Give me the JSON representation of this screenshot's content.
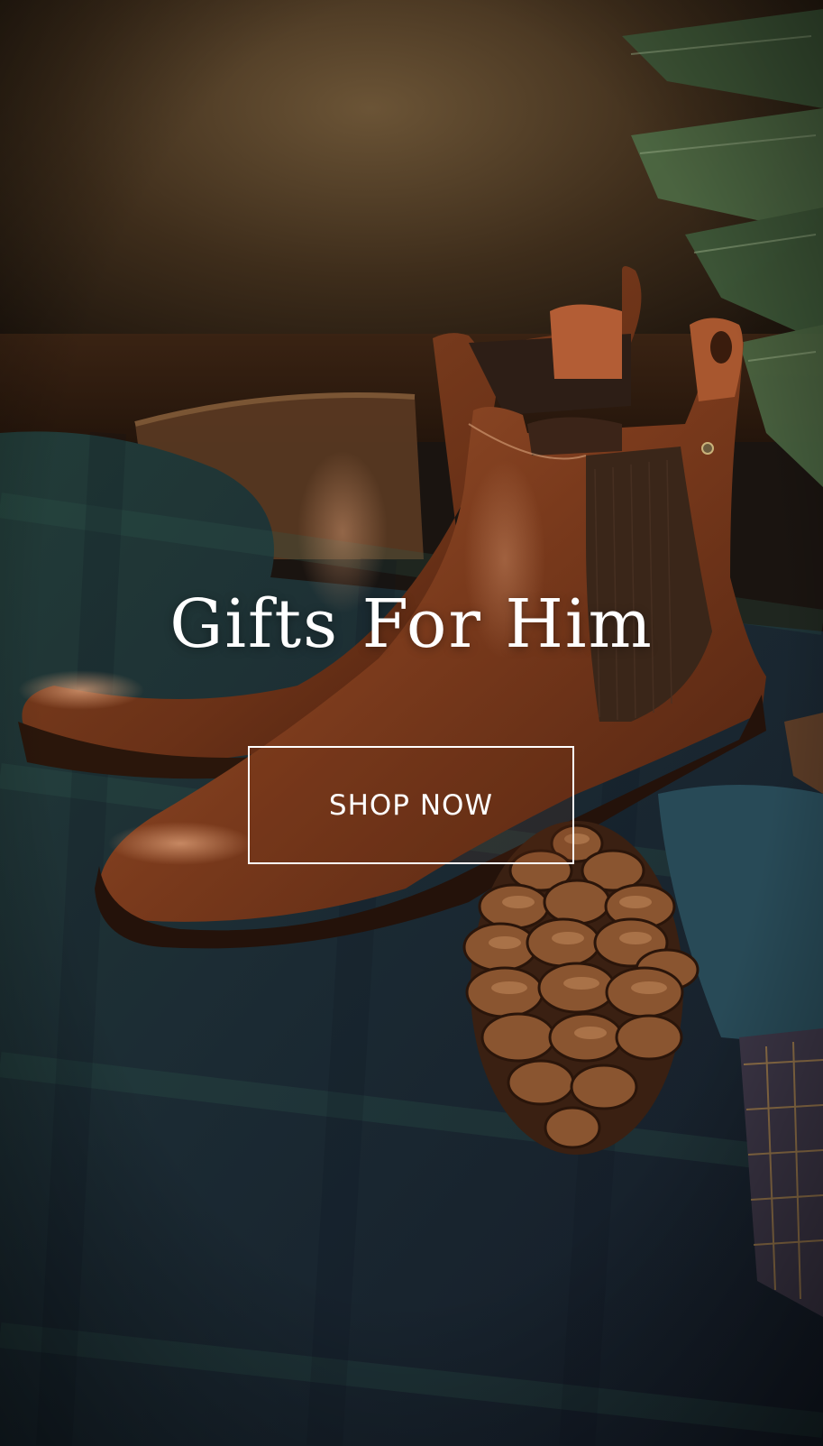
{
  "banner": {
    "headline": "Gifts For Him",
    "cta_label": "SHOP NOW"
  },
  "colors": {
    "text": "#ffffff",
    "boot_leather": "#7a3a1c",
    "tartan_green": "#1f3a35",
    "tartan_navy": "#1b2230",
    "wall": "#3a2a18"
  },
  "image": {
    "subject": "brown-leather-chelsea-boots-with-pinecone-on-tartan-blanket"
  }
}
